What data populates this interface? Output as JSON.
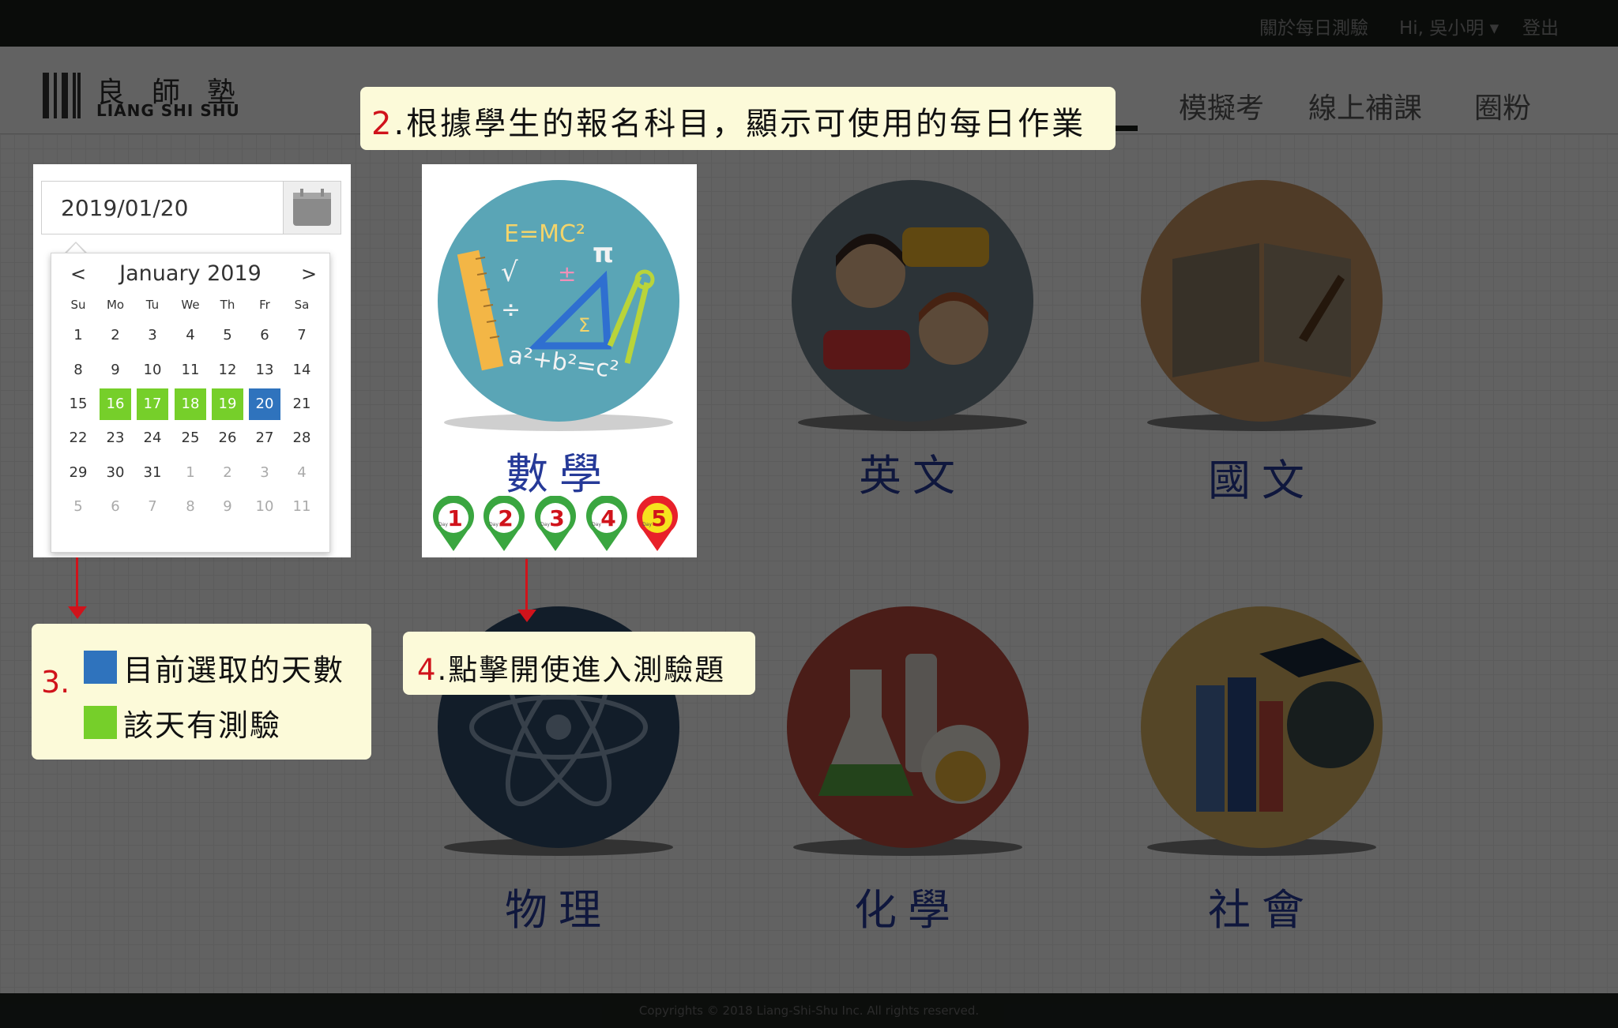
{
  "topbar": {
    "about": "關於每日測驗",
    "greeting": "Hi, 吳小明 ▾",
    "logout": "登出"
  },
  "logo": {
    "chinese": "良師塾",
    "english": "LIANG SHI SHU"
  },
  "nav": {
    "items": [
      "模擬考",
      "線上補課",
      "圈粉"
    ]
  },
  "date_picker": {
    "value": "2019/01/20",
    "month_title": "January 2019",
    "prev": "<",
    "next": ">",
    "weekdays": [
      "Su",
      "Mo",
      "Tu",
      "We",
      "Th",
      "Fr",
      "Sa"
    ],
    "weeks": [
      [
        "1",
        "2",
        "3",
        "4",
        "5",
        "6",
        "7"
      ],
      [
        "8",
        "9",
        "10",
        "11",
        "12",
        "13",
        "14"
      ],
      [
        "15",
        "16",
        "17",
        "18",
        "19",
        "20",
        "21"
      ],
      [
        "22",
        "23",
        "24",
        "25",
        "26",
        "27",
        "28"
      ],
      [
        "29",
        "30",
        "31",
        "1",
        "2",
        "3",
        "4"
      ],
      [
        "5",
        "6",
        "7",
        "8",
        "9",
        "10",
        "11"
      ]
    ],
    "test_days": [
      "16",
      "17",
      "18",
      "19"
    ],
    "selected_day": "20"
  },
  "subjects": {
    "math": "數學",
    "english": "英文",
    "chinese": "國文",
    "physics": "物理",
    "chemistry": "化學",
    "social": "社會"
  },
  "math_illustration": {
    "formula_1": "E=MC²",
    "formula_2": "a²+b²=c²",
    "pi": "π",
    "sigma": "Σ",
    "plus_minus": "±",
    "divide": "÷",
    "sqrt": "√"
  },
  "math_days": [
    {
      "label": "1",
      "day": "Day"
    },
    {
      "label": "2",
      "day": "Day"
    },
    {
      "label": "3",
      "day": "Day"
    },
    {
      "label": "4",
      "day": "Day"
    },
    {
      "label": "5",
      "day": "Day"
    }
  ],
  "callouts": {
    "step2_num": "2",
    "step2_text": ".根據學生的報名科目，顯示可使用的每日作業",
    "step3_num": "3.",
    "step3_selected": "目前選取的天數",
    "step3_has_test": "該天有測驗",
    "step4_num": "4",
    "step4_text": ".點擊開使進入測驗題"
  },
  "footer": {
    "copyright": "Copyrights © 2018 Liang-Shi-Shu Inc. All rights reserved."
  },
  "colors": {
    "selected": "#2f73bd",
    "has_test": "#76cf2a",
    "accent_red": "#d0131b",
    "subject_text": "#263a98"
  }
}
